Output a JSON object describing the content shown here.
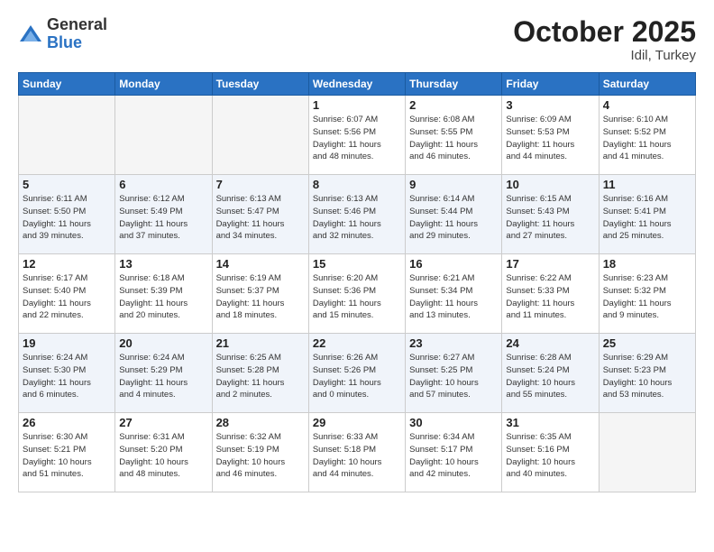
{
  "logo": {
    "general": "General",
    "blue": "Blue"
  },
  "header": {
    "month": "October 2025",
    "location": "Idil, Turkey"
  },
  "weekdays": [
    "Sunday",
    "Monday",
    "Tuesday",
    "Wednesday",
    "Thursday",
    "Friday",
    "Saturday"
  ],
  "weeks": [
    {
      "shaded": false,
      "days": [
        {
          "num": "",
          "detail": ""
        },
        {
          "num": "",
          "detail": ""
        },
        {
          "num": "",
          "detail": ""
        },
        {
          "num": "1",
          "detail": "Sunrise: 6:07 AM\nSunset: 5:56 PM\nDaylight: 11 hours\nand 48 minutes."
        },
        {
          "num": "2",
          "detail": "Sunrise: 6:08 AM\nSunset: 5:55 PM\nDaylight: 11 hours\nand 46 minutes."
        },
        {
          "num": "3",
          "detail": "Sunrise: 6:09 AM\nSunset: 5:53 PM\nDaylight: 11 hours\nand 44 minutes."
        },
        {
          "num": "4",
          "detail": "Sunrise: 6:10 AM\nSunset: 5:52 PM\nDaylight: 11 hours\nand 41 minutes."
        }
      ]
    },
    {
      "shaded": true,
      "days": [
        {
          "num": "5",
          "detail": "Sunrise: 6:11 AM\nSunset: 5:50 PM\nDaylight: 11 hours\nand 39 minutes."
        },
        {
          "num": "6",
          "detail": "Sunrise: 6:12 AM\nSunset: 5:49 PM\nDaylight: 11 hours\nand 37 minutes."
        },
        {
          "num": "7",
          "detail": "Sunrise: 6:13 AM\nSunset: 5:47 PM\nDaylight: 11 hours\nand 34 minutes."
        },
        {
          "num": "8",
          "detail": "Sunrise: 6:13 AM\nSunset: 5:46 PM\nDaylight: 11 hours\nand 32 minutes."
        },
        {
          "num": "9",
          "detail": "Sunrise: 6:14 AM\nSunset: 5:44 PM\nDaylight: 11 hours\nand 29 minutes."
        },
        {
          "num": "10",
          "detail": "Sunrise: 6:15 AM\nSunset: 5:43 PM\nDaylight: 11 hours\nand 27 minutes."
        },
        {
          "num": "11",
          "detail": "Sunrise: 6:16 AM\nSunset: 5:41 PM\nDaylight: 11 hours\nand 25 minutes."
        }
      ]
    },
    {
      "shaded": false,
      "days": [
        {
          "num": "12",
          "detail": "Sunrise: 6:17 AM\nSunset: 5:40 PM\nDaylight: 11 hours\nand 22 minutes."
        },
        {
          "num": "13",
          "detail": "Sunrise: 6:18 AM\nSunset: 5:39 PM\nDaylight: 11 hours\nand 20 minutes."
        },
        {
          "num": "14",
          "detail": "Sunrise: 6:19 AM\nSunset: 5:37 PM\nDaylight: 11 hours\nand 18 minutes."
        },
        {
          "num": "15",
          "detail": "Sunrise: 6:20 AM\nSunset: 5:36 PM\nDaylight: 11 hours\nand 15 minutes."
        },
        {
          "num": "16",
          "detail": "Sunrise: 6:21 AM\nSunset: 5:34 PM\nDaylight: 11 hours\nand 13 minutes."
        },
        {
          "num": "17",
          "detail": "Sunrise: 6:22 AM\nSunset: 5:33 PM\nDaylight: 11 hours\nand 11 minutes."
        },
        {
          "num": "18",
          "detail": "Sunrise: 6:23 AM\nSunset: 5:32 PM\nDaylight: 11 hours\nand 9 minutes."
        }
      ]
    },
    {
      "shaded": true,
      "days": [
        {
          "num": "19",
          "detail": "Sunrise: 6:24 AM\nSunset: 5:30 PM\nDaylight: 11 hours\nand 6 minutes."
        },
        {
          "num": "20",
          "detail": "Sunrise: 6:24 AM\nSunset: 5:29 PM\nDaylight: 11 hours\nand 4 minutes."
        },
        {
          "num": "21",
          "detail": "Sunrise: 6:25 AM\nSunset: 5:28 PM\nDaylight: 11 hours\nand 2 minutes."
        },
        {
          "num": "22",
          "detail": "Sunrise: 6:26 AM\nSunset: 5:26 PM\nDaylight: 11 hours\nand 0 minutes."
        },
        {
          "num": "23",
          "detail": "Sunrise: 6:27 AM\nSunset: 5:25 PM\nDaylight: 10 hours\nand 57 minutes."
        },
        {
          "num": "24",
          "detail": "Sunrise: 6:28 AM\nSunset: 5:24 PM\nDaylight: 10 hours\nand 55 minutes."
        },
        {
          "num": "25",
          "detail": "Sunrise: 6:29 AM\nSunset: 5:23 PM\nDaylight: 10 hours\nand 53 minutes."
        }
      ]
    },
    {
      "shaded": false,
      "days": [
        {
          "num": "26",
          "detail": "Sunrise: 6:30 AM\nSunset: 5:21 PM\nDaylight: 10 hours\nand 51 minutes."
        },
        {
          "num": "27",
          "detail": "Sunrise: 6:31 AM\nSunset: 5:20 PM\nDaylight: 10 hours\nand 48 minutes."
        },
        {
          "num": "28",
          "detail": "Sunrise: 6:32 AM\nSunset: 5:19 PM\nDaylight: 10 hours\nand 46 minutes."
        },
        {
          "num": "29",
          "detail": "Sunrise: 6:33 AM\nSunset: 5:18 PM\nDaylight: 10 hours\nand 44 minutes."
        },
        {
          "num": "30",
          "detail": "Sunrise: 6:34 AM\nSunset: 5:17 PM\nDaylight: 10 hours\nand 42 minutes."
        },
        {
          "num": "31",
          "detail": "Sunrise: 6:35 AM\nSunset: 5:16 PM\nDaylight: 10 hours\nand 40 minutes."
        },
        {
          "num": "",
          "detail": ""
        }
      ]
    }
  ]
}
